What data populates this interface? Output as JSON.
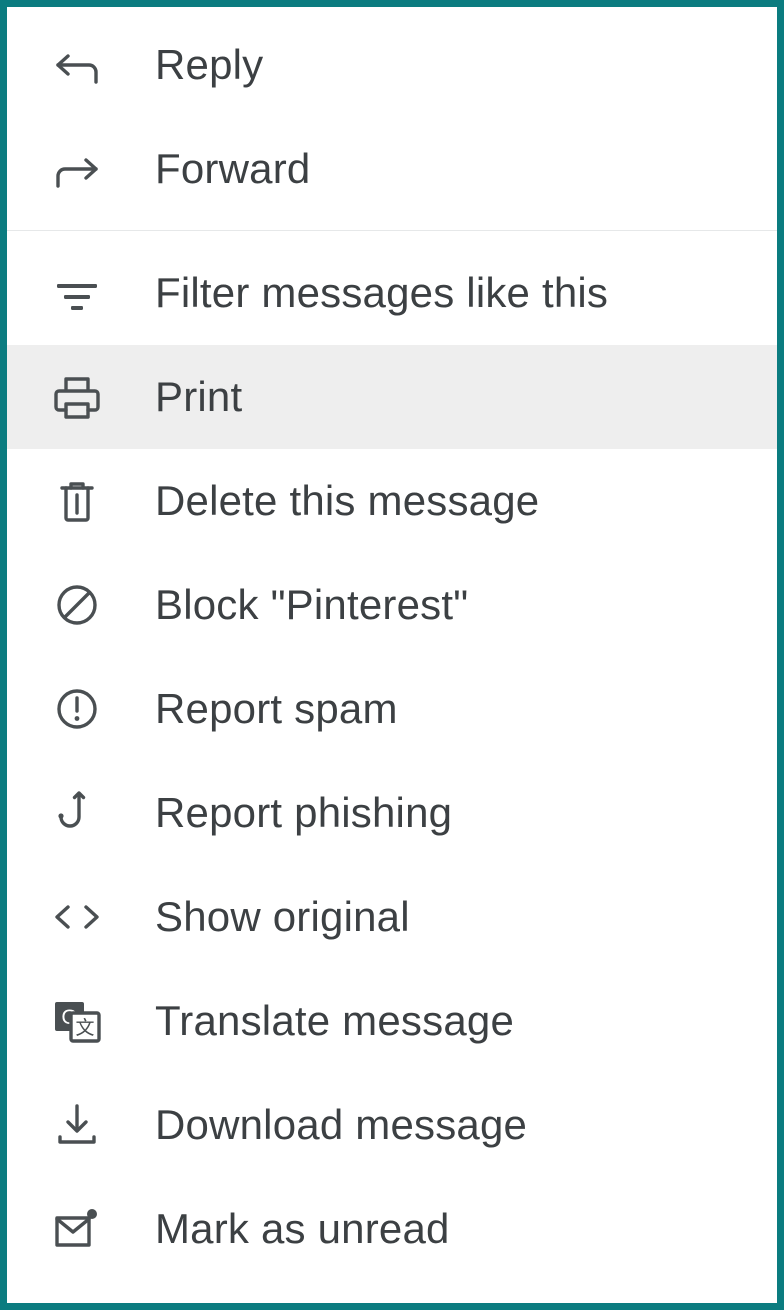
{
  "theme": {
    "border_color": "#0b7c80",
    "background": "#ffffff",
    "text_color": "#3c4043",
    "icon_color": "#4a4f52",
    "highlight_color": "#eeeeee",
    "divider_color": "#e6e8e9"
  },
  "menu": {
    "name": "message-more-options-menu",
    "groups": [
      {
        "id": "reply-group",
        "items": [
          {
            "id": "reply",
            "label": "Reply",
            "icon": "reply-arrow-icon",
            "highlighted": false
          },
          {
            "id": "forward",
            "label": "Forward",
            "icon": "forward-arrow-icon",
            "highlighted": false
          }
        ]
      },
      {
        "id": "actions-group",
        "items": [
          {
            "id": "filter-messages-like-this",
            "label": "Filter messages like this",
            "icon": "filter-icon",
            "highlighted": false
          },
          {
            "id": "print",
            "label": "Print",
            "icon": "printer-icon",
            "highlighted": true
          },
          {
            "id": "delete-this-message",
            "label": "Delete this message",
            "icon": "trash-icon",
            "highlighted": false
          },
          {
            "id": "block-sender",
            "label": "Block \"Pinterest\"",
            "icon": "block-circle-slash-icon",
            "highlighted": false
          },
          {
            "id": "report-spam",
            "label": "Report spam",
            "icon": "exclamation-circle-icon",
            "highlighted": false
          },
          {
            "id": "report-phishing",
            "label": "Report phishing",
            "icon": "fishhook-icon",
            "highlighted": false
          },
          {
            "id": "show-original",
            "label": "Show original",
            "icon": "code-brackets-icon",
            "highlighted": false
          },
          {
            "id": "translate-message",
            "label": "Translate message",
            "icon": "translate-icon",
            "highlighted": false
          },
          {
            "id": "download-message",
            "label": "Download message",
            "icon": "download-icon",
            "highlighted": false
          },
          {
            "id": "mark-as-unread",
            "label": "Mark as unread",
            "icon": "envelope-unread-icon",
            "highlighted": false
          }
        ]
      }
    ]
  }
}
